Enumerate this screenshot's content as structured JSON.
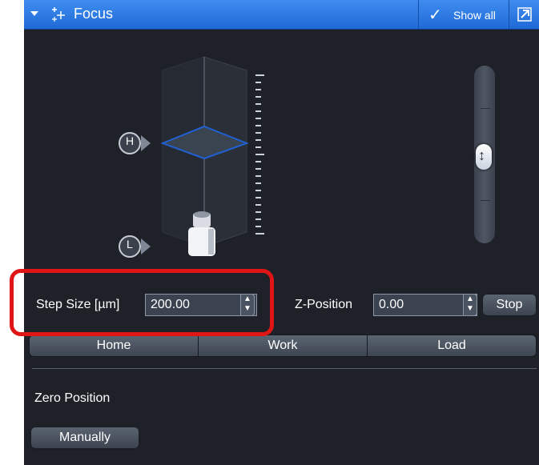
{
  "titlebar": {
    "title": "Focus",
    "show_all_label": "Show all",
    "check_glyph": "✓",
    "accent_color": "#2a78e4"
  },
  "visual": {
    "marker_high": "H",
    "marker_low": "L"
  },
  "step_size": {
    "label": "Step Size [µm]",
    "value": "200.00"
  },
  "z_position": {
    "label": "Z-Position",
    "value": "0.00",
    "stop_label": "Stop"
  },
  "position_buttons": [
    "Home",
    "Work",
    "Load"
  ],
  "zero_position": {
    "heading": "Zero Position",
    "manually_label": "Manually"
  },
  "colors": {
    "panel_bg": "#1e2228",
    "highlight": "#e01515",
    "focus_plane": "#2060d0"
  },
  "icons": [
    "chevron-down-icon",
    "focus-icon",
    "check-icon",
    "undock-icon",
    "spin-up-icon",
    "spin-down-icon",
    "slider-thumb-icon",
    "objective-icon"
  ]
}
